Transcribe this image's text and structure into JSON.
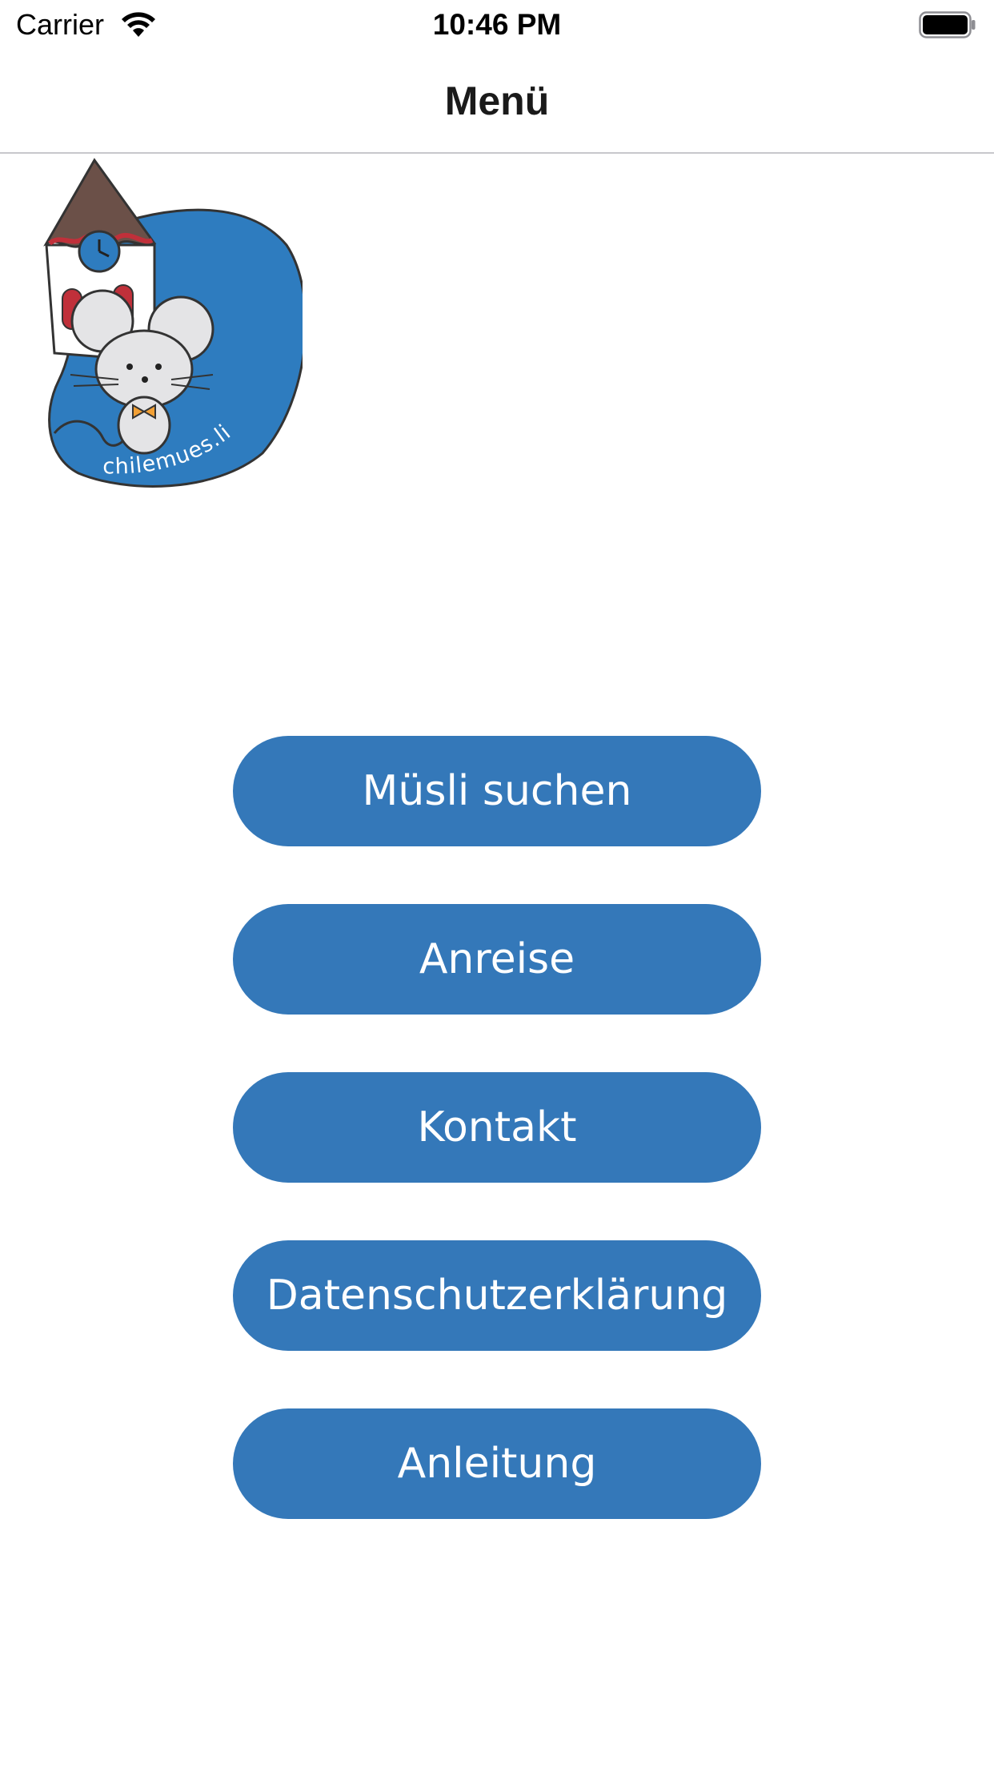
{
  "status_bar": {
    "carrier": "Carrier",
    "time": "10:46 PM",
    "wifi_icon": "wifi-icon",
    "battery_icon": "battery-icon"
  },
  "nav": {
    "title": "Menü"
  },
  "logo": {
    "text": "chilemues.li",
    "icon": "mouse-church-logo"
  },
  "colors": {
    "button_bg": "#3478b9",
    "button_text": "#ffffff",
    "logo_blue": "#2e7cbf",
    "divider": "#c8c8cc"
  },
  "menu": {
    "items": [
      {
        "label": "Müsli suchen"
      },
      {
        "label": "Anreise"
      },
      {
        "label": "Kontakt"
      },
      {
        "label": "Datenschutzerklärung"
      },
      {
        "label": "Anleitung"
      }
    ]
  }
}
